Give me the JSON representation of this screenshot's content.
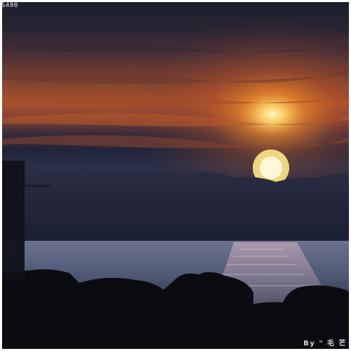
{
  "photo": {
    "camera_label": "S400",
    "signature": "By \" 毛 芒",
    "palette": {
      "sky_top": "#1c2030",
      "sky_mid": "#3a2c36",
      "cloud_glow": "#c4602c",
      "sun_core": "#fff4b0",
      "sun_halo": "#f0902a",
      "sea": "#5a6580",
      "sea_reflection": "#b89aa8",
      "rocks": "#0c0c12"
    },
    "icon": "sunset-photo"
  }
}
